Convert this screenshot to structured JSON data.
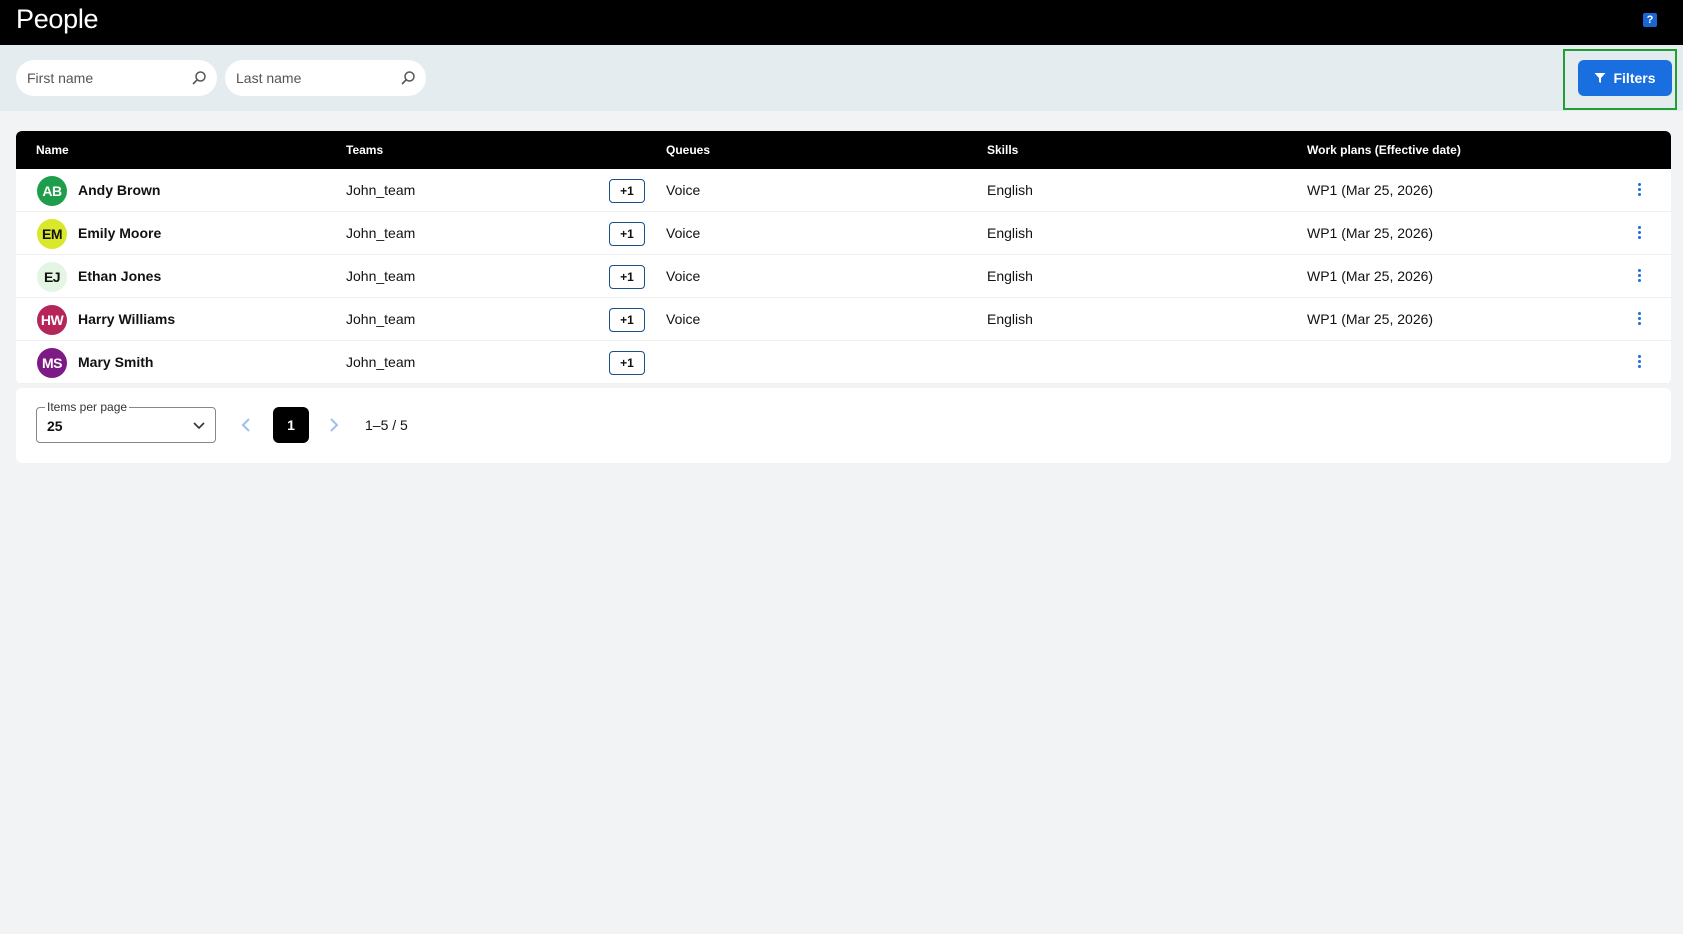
{
  "header": {
    "title": "People",
    "help_icon": "help-icon"
  },
  "search": {
    "first_name_placeholder": "First name",
    "last_name_placeholder": "Last name"
  },
  "toolbar": {
    "filters_label": "Filters"
  },
  "table": {
    "columns": [
      "Name",
      "Teams",
      "Queues",
      "Skills",
      "Work plans (Effective date)"
    ],
    "rows": [
      {
        "initials": "AB",
        "name": "Andy Brown",
        "team": "John_team",
        "more": "+1",
        "queue": "Voice",
        "skill": "English",
        "plan": "WP1 (Mar 25, 2026)",
        "avatar_bg": "#1e9e4a",
        "avatar_fg": "#ffffff"
      },
      {
        "initials": "EM",
        "name": "Emily Moore",
        "team": "John_team",
        "more": "+1",
        "queue": "Voice",
        "skill": "English",
        "plan": "WP1 (Mar 25, 2026)",
        "avatar_bg": "#d9e82a",
        "avatar_fg": "#111111"
      },
      {
        "initials": "EJ",
        "name": "Ethan Jones",
        "team": "John_team",
        "more": "+1",
        "queue": "Voice",
        "skill": "English",
        "plan": "WP1 (Mar 25, 2026)",
        "avatar_bg": "#e3f6e3",
        "avatar_fg": "#111111"
      },
      {
        "initials": "HW",
        "name": "Harry Williams",
        "team": "John_team",
        "more": "+1",
        "queue": "Voice",
        "skill": "English",
        "plan": "WP1 (Mar 25, 2026)",
        "avatar_bg": "#b5255a",
        "avatar_fg": "#ffffff"
      },
      {
        "initials": "MS",
        "name": "Mary Smith",
        "team": "John_team",
        "more": "+1",
        "queue": "",
        "skill": "",
        "plan": "",
        "avatar_bg": "#7c1a86",
        "avatar_fg": "#ffffff"
      }
    ]
  },
  "pagination": {
    "items_per_page_label": "Items per page",
    "items_per_page_value": "25",
    "current_page": "1",
    "range": "1–5 / 5"
  },
  "colors": {
    "accent": "#1a6fe0",
    "highlight": "#1e9e33"
  }
}
